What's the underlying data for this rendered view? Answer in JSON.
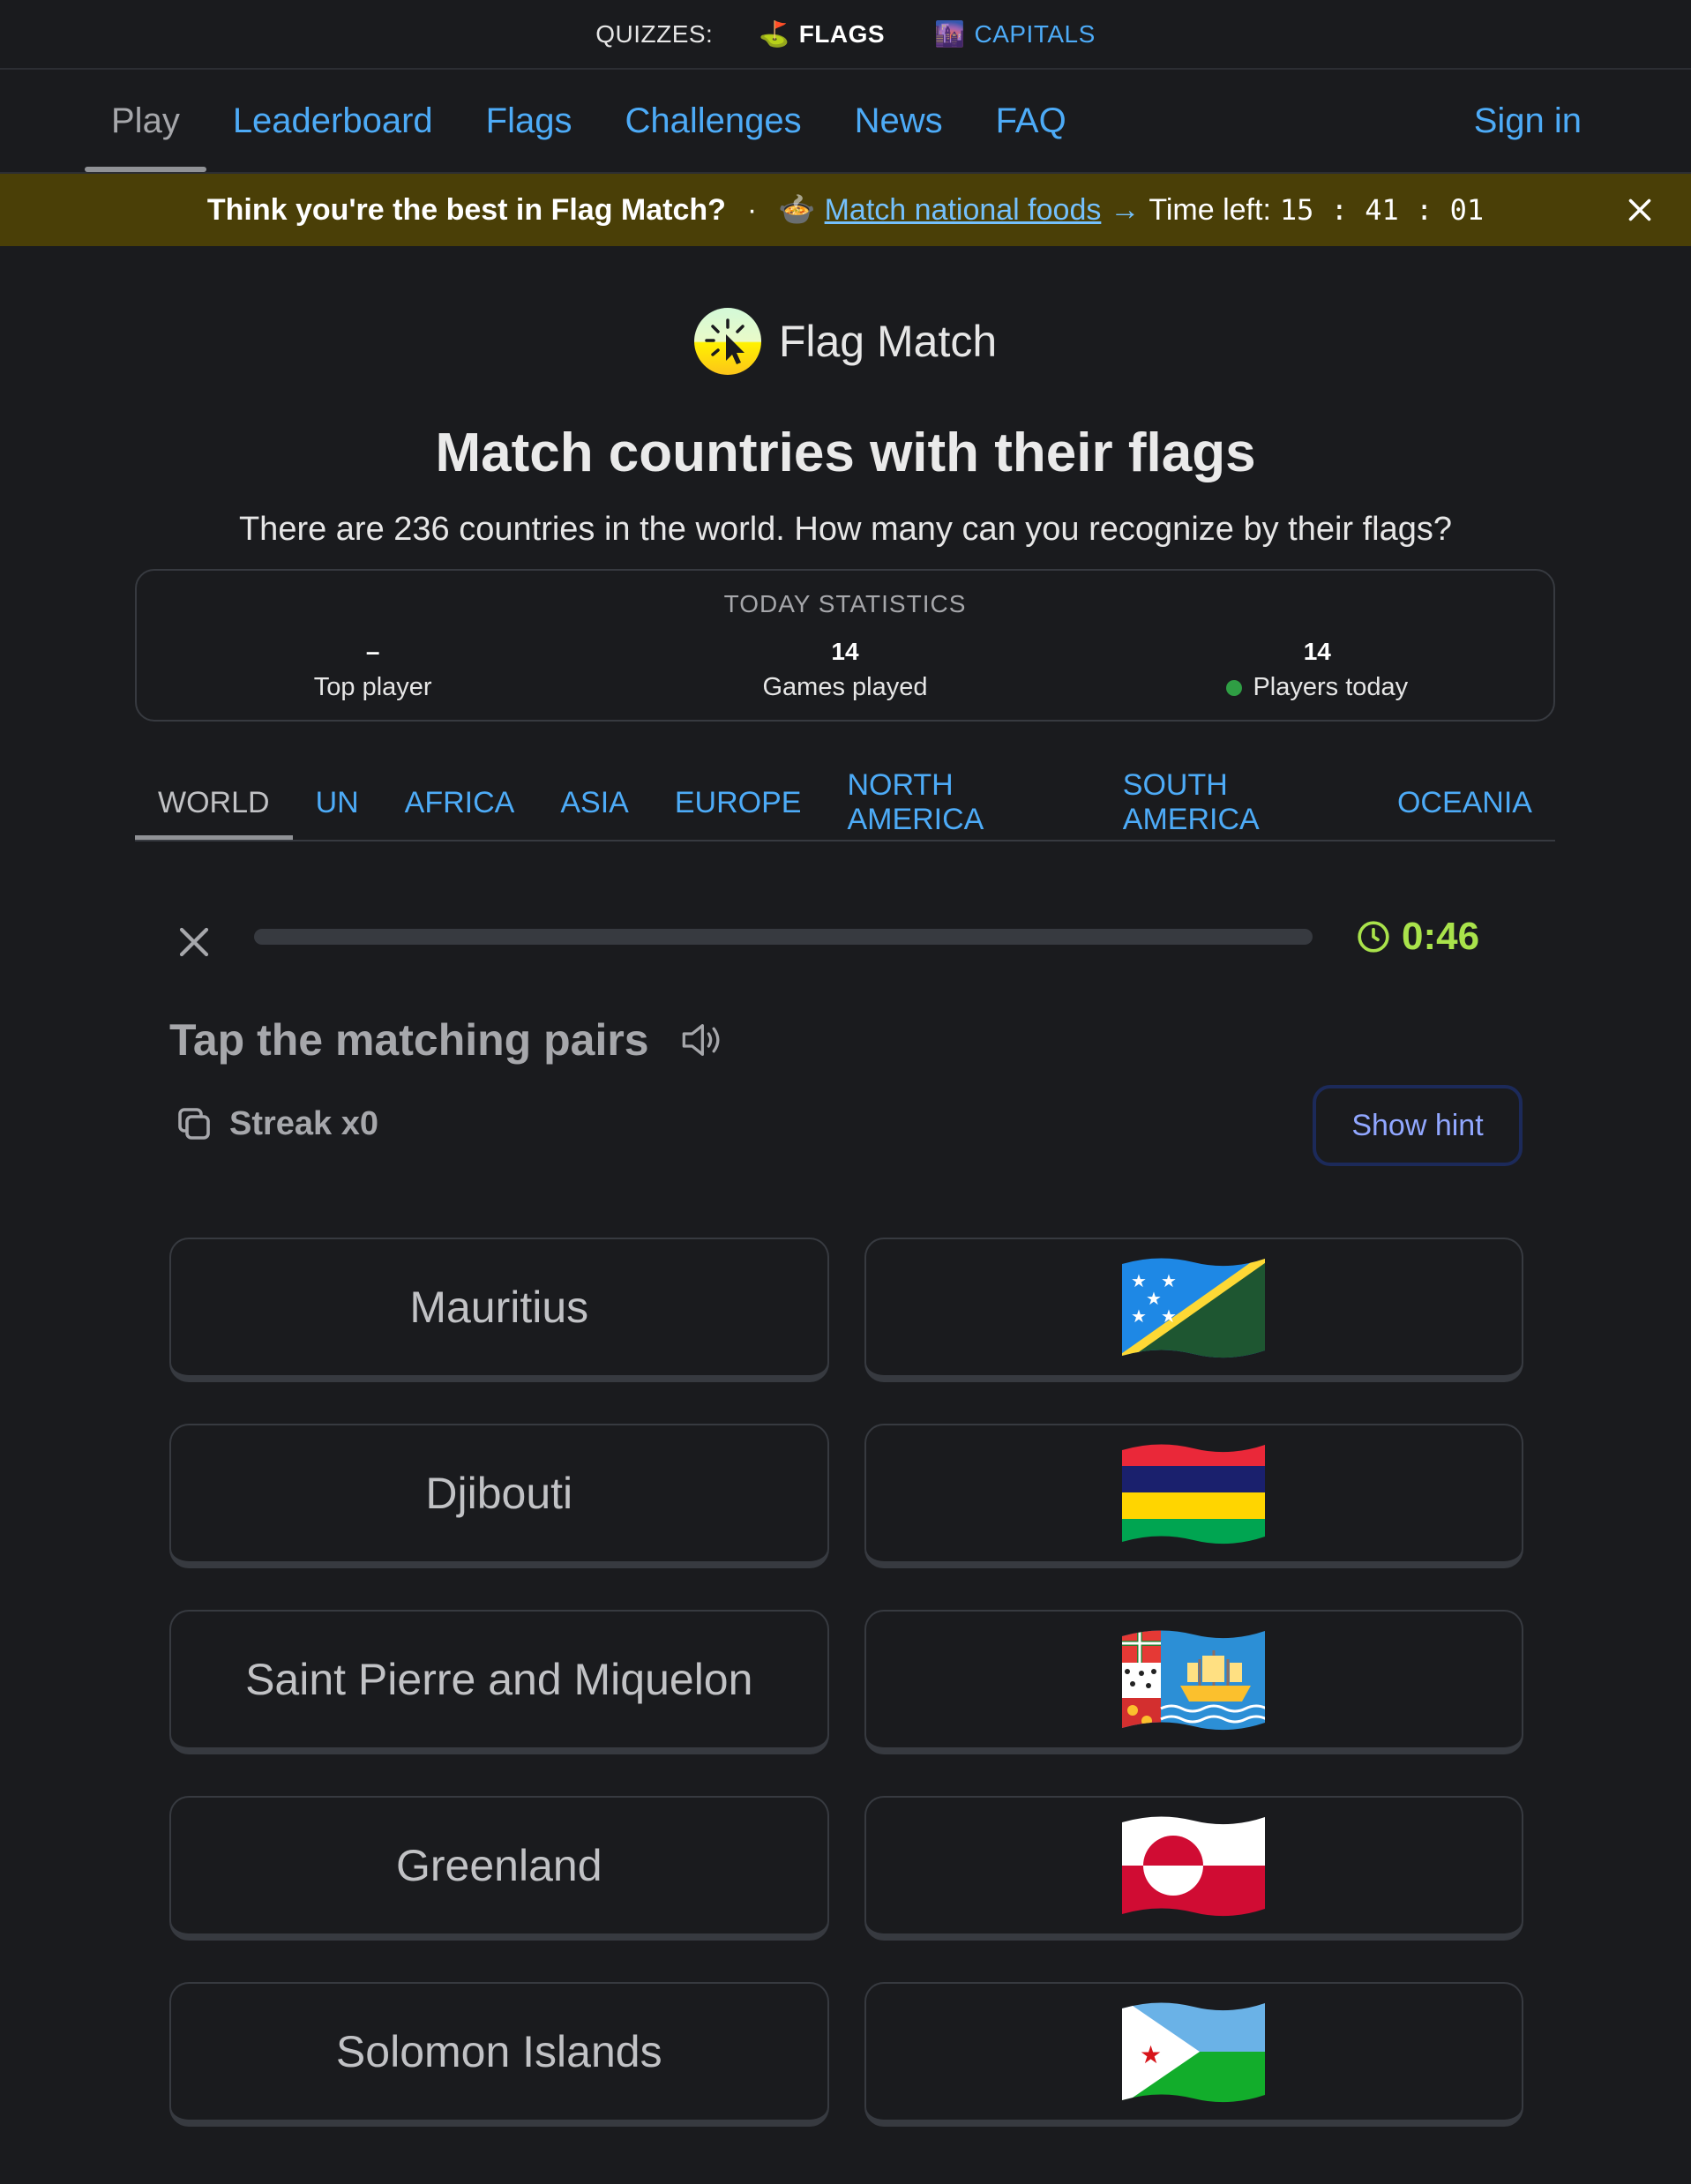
{
  "quizbar": {
    "label": "QUIZZES:",
    "flags": {
      "icon": "⛳",
      "label": "FLAGS"
    },
    "capitals": {
      "icon": "🌆",
      "label": "CAPITALS"
    }
  },
  "nav": {
    "items": [
      "Play",
      "Leaderboard",
      "Flags",
      "Challenges",
      "News",
      "FAQ"
    ],
    "active": "Play",
    "signin": "Sign in"
  },
  "banner": {
    "lead": "Think you're the best in Flag Match?",
    "separator": "·",
    "food_icon": "🍲",
    "link": "Match national foods",
    "arrow": "→",
    "time_label": "Time left:",
    "time_value": "15 : 41 : 01"
  },
  "hero": {
    "brand": "Flag Match",
    "title": "Match countries with their flags",
    "subtitle": "There are 236 countries in the world. How many can you recognize by their flags?"
  },
  "stats": {
    "title": "TODAY STATISTICS",
    "top_player": {
      "value": "–",
      "label": "Top player"
    },
    "games_played": {
      "value": "14",
      "label": "Games played"
    },
    "players_today": {
      "value": "14",
      "label": "Players today"
    }
  },
  "regions": {
    "tabs": [
      "WORLD",
      "UN",
      "AFRICA",
      "ASIA",
      "EUROPE",
      "NORTH AMERICA",
      "SOUTH AMERICA",
      "OCEANIA"
    ],
    "active": "WORLD"
  },
  "game": {
    "progress": 0.0,
    "time": "0:46",
    "instruction": "Tap the matching pairs",
    "streak": "Streak x0",
    "hint": "Show hint",
    "names": [
      "Mauritius",
      "Djibouti",
      "Saint Pierre and Miquelon",
      "Greenland",
      "Solomon Islands"
    ],
    "flags": [
      "Solomon Islands flag",
      "Mauritius flag",
      "Saint Pierre and Miquelon flag",
      "Greenland flag",
      "Djibouti flag"
    ]
  },
  "colors": {
    "background": "#1a1b1e",
    "link": "#4dabf7",
    "banner": "#4a3f07",
    "timer": "#a9e34b",
    "border": "#373a40"
  },
  "icons": [
    "close-icon",
    "clock-icon",
    "speaker-icon",
    "copy-icon",
    "flag-match-logo"
  ]
}
